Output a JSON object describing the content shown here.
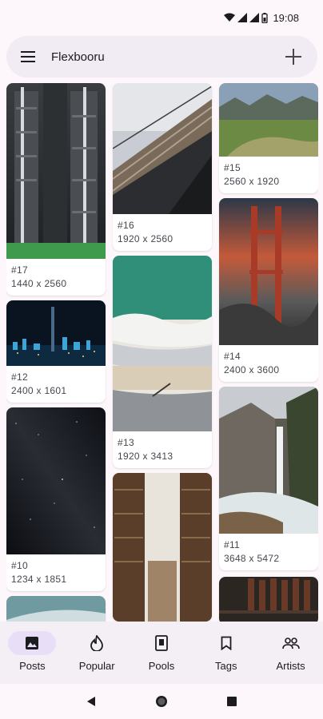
{
  "status": {
    "time": "19:08"
  },
  "app_bar": {
    "title": "Flexbooru"
  },
  "posts": [
    {
      "id": "#17",
      "size": "1440 x 2560"
    },
    {
      "id": "#16",
      "size": "1920 x 2560"
    },
    {
      "id": "#15",
      "size": "2560 x 1920"
    },
    {
      "id": "#12",
      "size": "2400 x 1601"
    },
    {
      "id": "#14",
      "size": "2400 x 3600"
    },
    {
      "id": "#13",
      "size": "1920 x 3413"
    },
    {
      "id": "#10",
      "size": "1234 x 1851"
    },
    {
      "id": "#11",
      "size": "3648 x 5472"
    }
  ],
  "bottom_nav": {
    "items": [
      {
        "label": "Posts",
        "icon": "image-icon",
        "active": true
      },
      {
        "label": "Popular",
        "icon": "flame-icon"
      },
      {
        "label": "Pools",
        "icon": "pool-icon"
      },
      {
        "label": "Tags",
        "icon": "bookmark-icon"
      },
      {
        "label": "Artists",
        "icon": "people-icon"
      }
    ]
  },
  "colors": {
    "background": "#fdf7fb",
    "app_bar": "#f1ebf3",
    "active_indicator": "#e8def8"
  }
}
